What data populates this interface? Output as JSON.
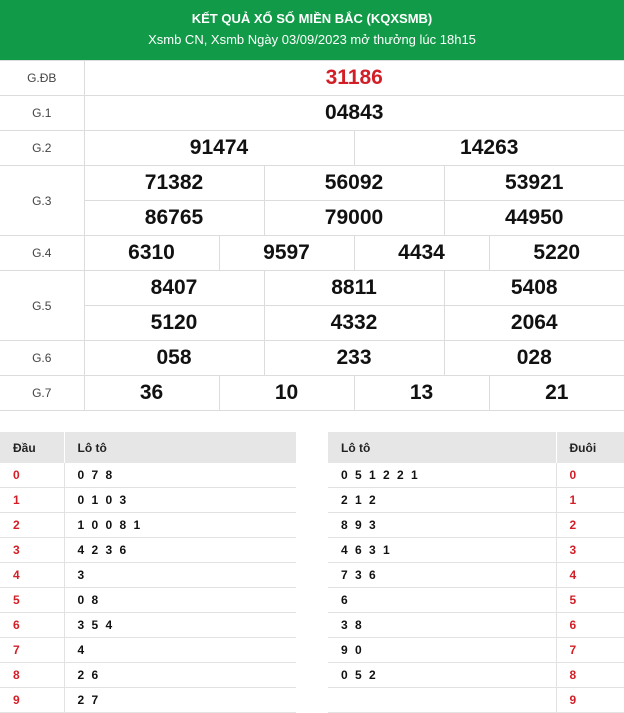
{
  "header": {
    "title": "KẾT QUẢ XỔ SỐ MIỀN BẮC (KQXSMB)",
    "subtitle": "Xsmb CN, Xsmb Ngày 03/09/2023 mở thưởng lúc 18h15"
  },
  "prizes": {
    "gdb": {
      "label": "G.ĐB",
      "nums": [
        "31186"
      ]
    },
    "g1": {
      "label": "G.1",
      "nums": [
        "04843"
      ]
    },
    "g2": {
      "label": "G.2",
      "nums": [
        "91474",
        "14263"
      ]
    },
    "g3": {
      "label": "G.3",
      "nums": [
        "71382",
        "56092",
        "53921",
        "86765",
        "79000",
        "44950"
      ]
    },
    "g4": {
      "label": "G.4",
      "nums": [
        "6310",
        "9597",
        "4434",
        "5220"
      ]
    },
    "g5": {
      "label": "G.5",
      "nums": [
        "8407",
        "8811",
        "5408",
        "5120",
        "4332",
        "2064"
      ]
    },
    "g6": {
      "label": "G.6",
      "nums": [
        "058",
        "233",
        "028"
      ]
    },
    "g7": {
      "label": "G.7",
      "nums": [
        "36",
        "10",
        "13",
        "21"
      ]
    }
  },
  "dau_table": {
    "head_col": "Đầu",
    "loto_col": "Lô tô",
    "rows": [
      {
        "k": "0",
        "v": "0 7 8"
      },
      {
        "k": "1",
        "v": "0 1 0 3"
      },
      {
        "k": "2",
        "v": "1 0 0 8 1"
      },
      {
        "k": "3",
        "v": "4 2 3 6"
      },
      {
        "k": "4",
        "v": "3"
      },
      {
        "k": "5",
        "v": "0 8"
      },
      {
        "k": "6",
        "v": "3 5 4"
      },
      {
        "k": "7",
        "v": "4"
      },
      {
        "k": "8",
        "v": "2 6"
      },
      {
        "k": "9",
        "v": "2 7"
      }
    ]
  },
  "duoi_table": {
    "loto_col": "Lô tô",
    "tail_col": "Đuôi",
    "rows": [
      {
        "k": "0",
        "v": "0 5 1 2 2 1"
      },
      {
        "k": "1",
        "v": "2 1 2"
      },
      {
        "k": "2",
        "v": "8 9 3"
      },
      {
        "k": "3",
        "v": "4 6 3 1"
      },
      {
        "k": "4",
        "v": "7 3 6"
      },
      {
        "k": "5",
        "v": "6"
      },
      {
        "k": "6",
        "v": "3 8"
      },
      {
        "k": "7",
        "v": "9 0"
      },
      {
        "k": "8",
        "v": "0 5 2"
      },
      {
        "k": "9",
        "v": ""
      }
    ]
  }
}
